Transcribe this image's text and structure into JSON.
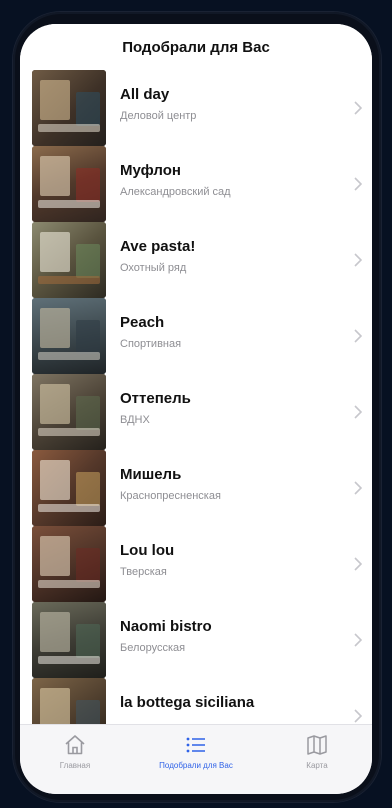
{
  "header": {
    "title": "Подобрали для Вас"
  },
  "colors": {
    "accent": "#2f62e8",
    "secondary_text": "#8e8e93",
    "tab_inactive": "#9a9aa0"
  },
  "restaurants": [
    {
      "name": "All day",
      "subtitle": "Деловой центр"
    },
    {
      "name": "Муфлон",
      "subtitle": "Александровский сад"
    },
    {
      "name": "Ave pasta!",
      "subtitle": "Охотный ряд"
    },
    {
      "name": "Peach",
      "subtitle": "Спортивная"
    },
    {
      "name": "Оттепель",
      "subtitle": "ВДНХ"
    },
    {
      "name": "Мишель",
      "subtitle": "Краснопресненская"
    },
    {
      "name": "Lou lou",
      "subtitle": "Тверская"
    },
    {
      "name": "Naomi bistro",
      "subtitle": "Белорусская"
    },
    {
      "name": "la bottega siciliana",
      "subtitle": ""
    }
  ],
  "tabbar": {
    "tabs": [
      {
        "label": "Главная",
        "icon": "home-icon",
        "active": false
      },
      {
        "label": "Подобрали для Вас",
        "icon": "list-icon",
        "active": true
      },
      {
        "label": "Карта",
        "icon": "map-icon",
        "active": false
      }
    ]
  }
}
